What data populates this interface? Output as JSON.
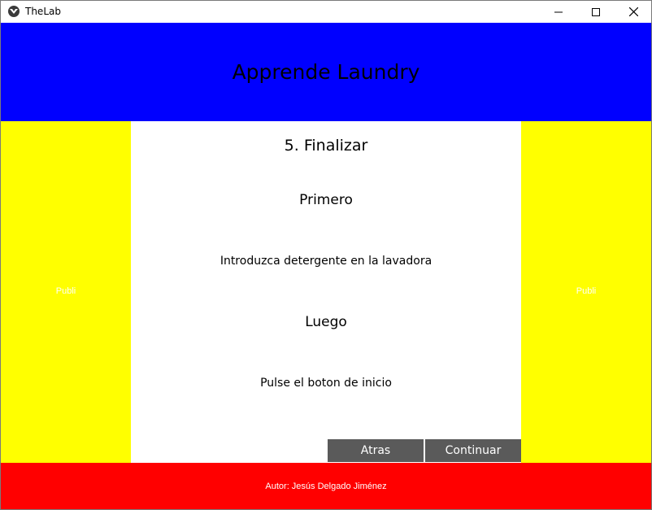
{
  "window": {
    "title": "TheLab"
  },
  "header": {
    "title": "Apprende Laundry"
  },
  "sidebar_left": {
    "label": "Publi"
  },
  "sidebar_right": {
    "label": "Publi"
  },
  "main": {
    "step_title": "5. Finalizar",
    "first_heading": "Primero",
    "first_text": "Introduzca detergente en la lavadora",
    "then_heading": "Luego",
    "then_text": "Pulse el boton de inicio",
    "back_label": "Atras",
    "continue_label": "Continuar"
  },
  "footer": {
    "author": "Autor: Jesús Delgado Jiménez"
  },
  "colors": {
    "header": "#0000ff",
    "sidebar": "#ffff00",
    "footer": "#ff0000",
    "button": "#5a5a5a"
  }
}
